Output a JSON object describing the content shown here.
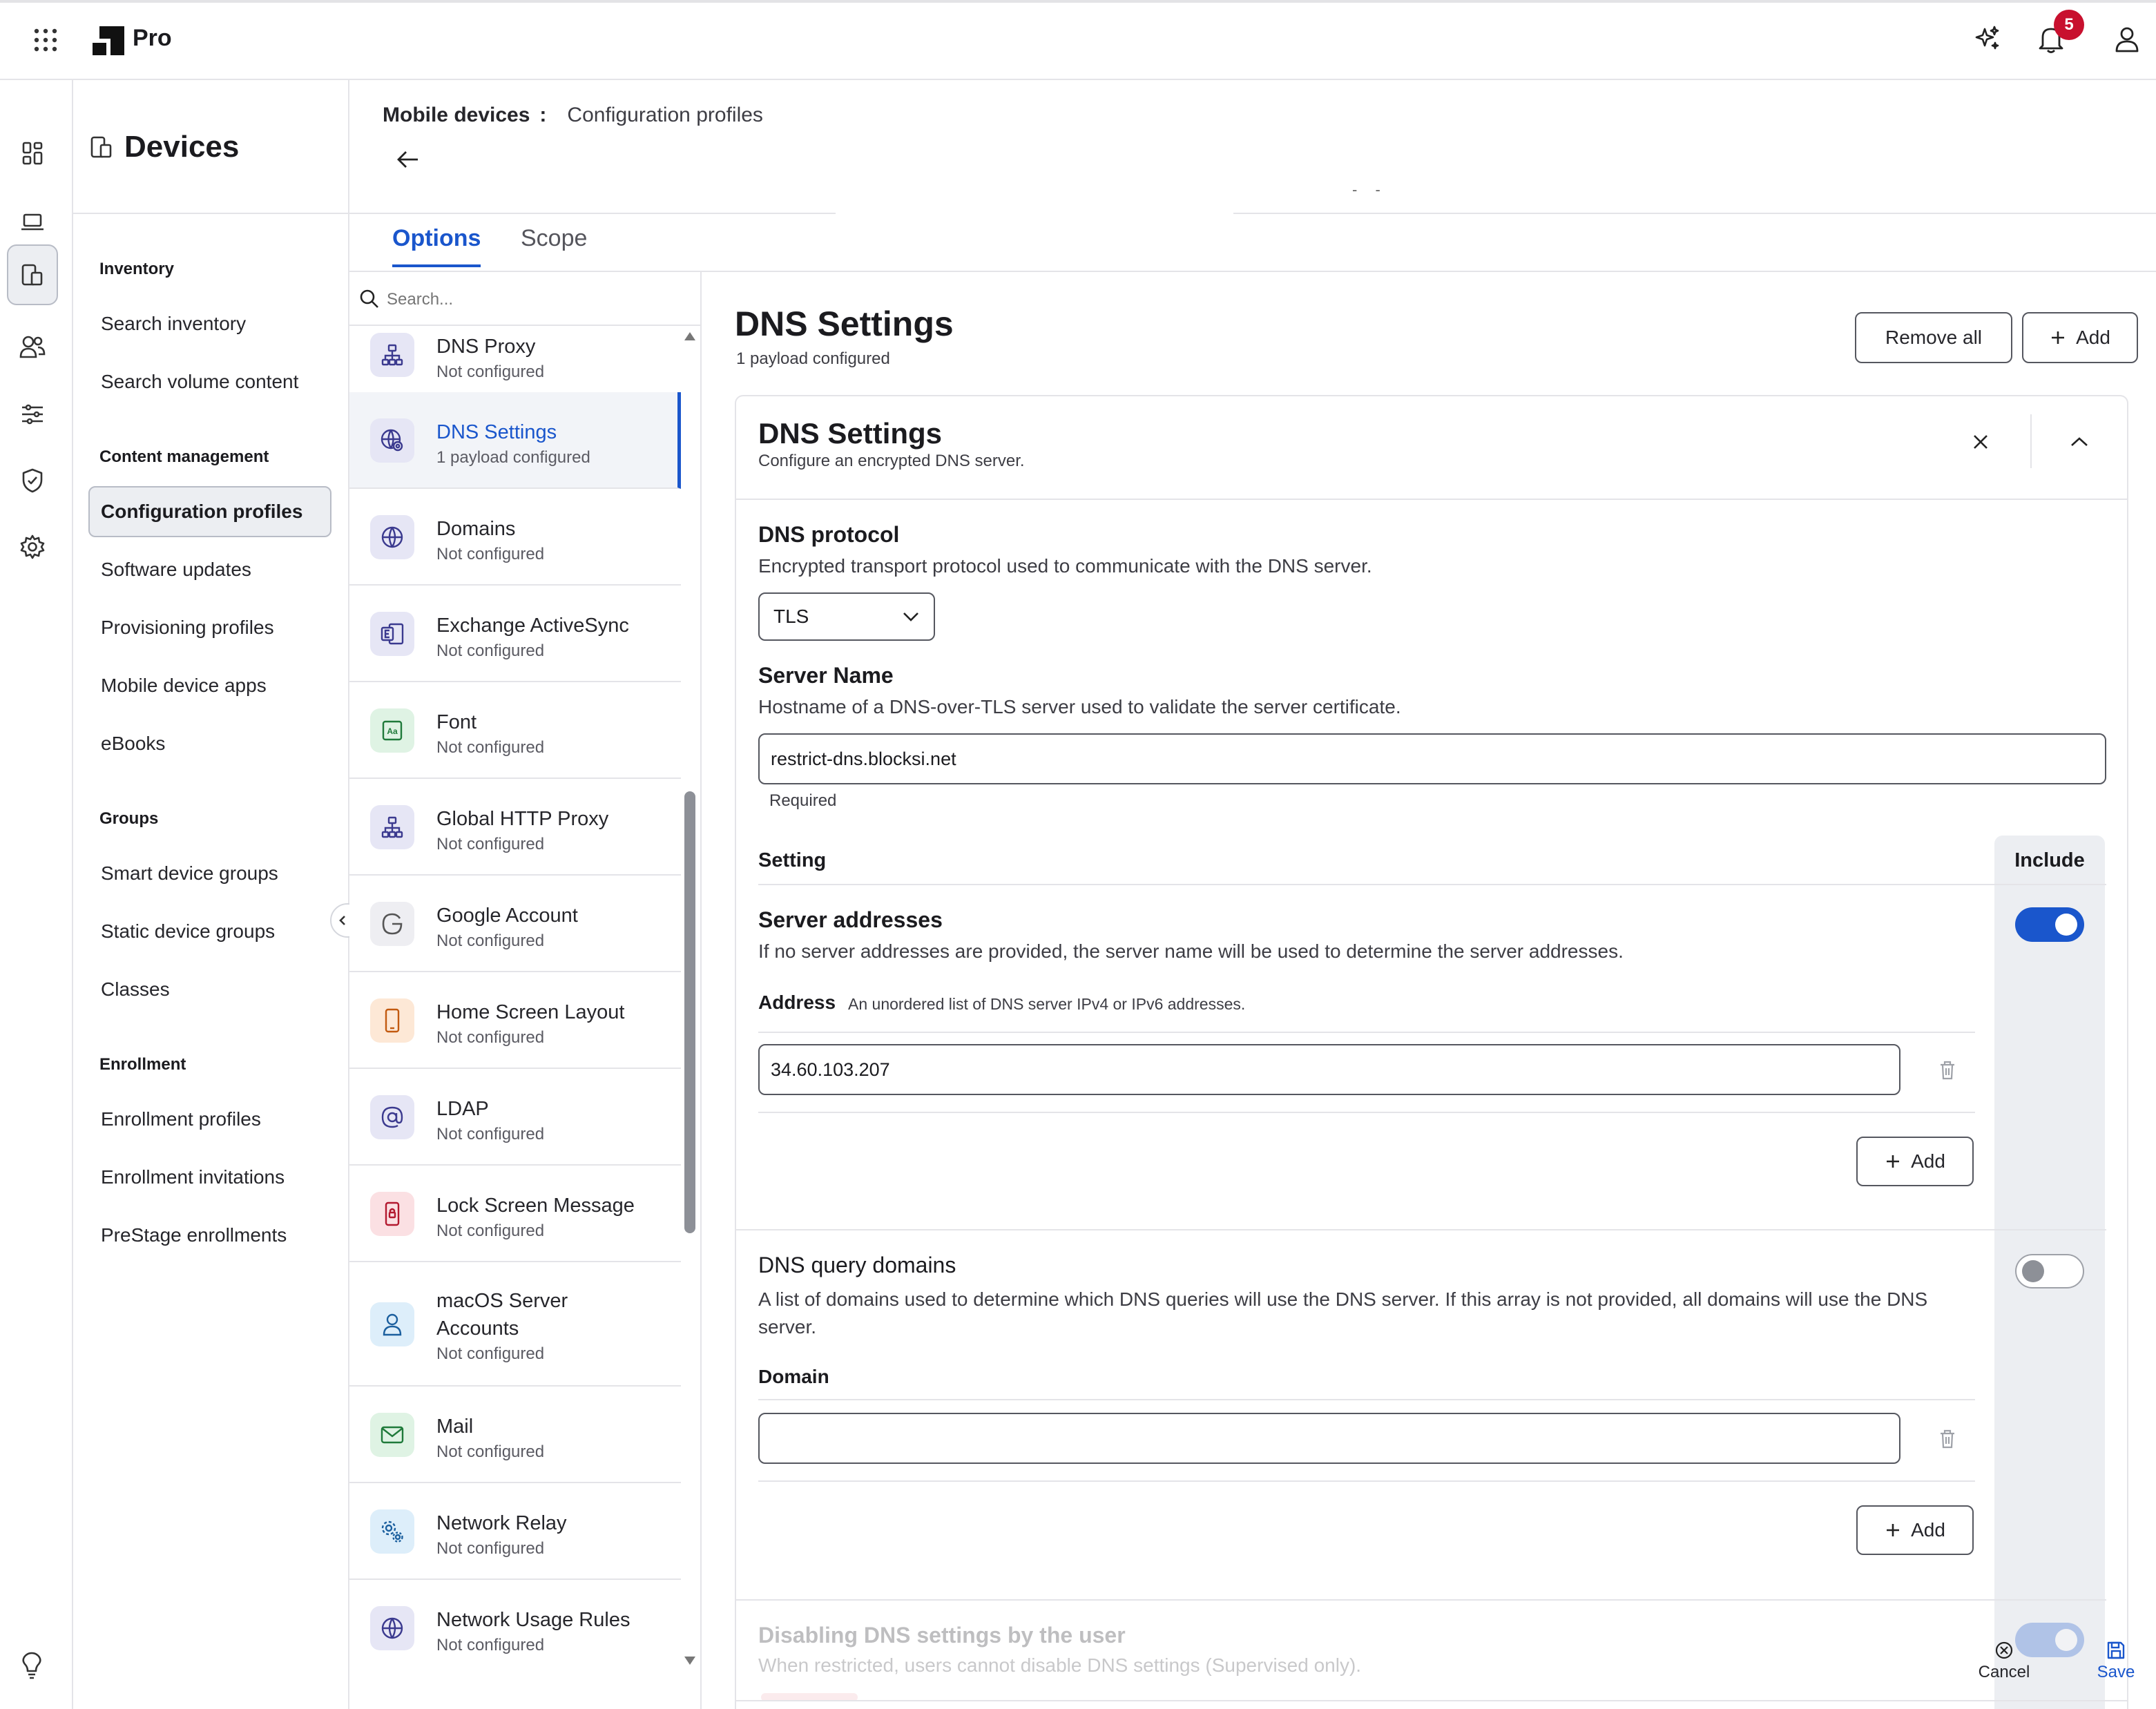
{
  "app": {
    "brand": "Pro",
    "notifications_count": "5"
  },
  "rail": {
    "icons": [
      "dashboard-icon",
      "computer-icon",
      "mobile-devices-icon",
      "users-icon",
      "settings-sliders-icon",
      "shield-icon",
      "gear-icon",
      "lightbulb-icon"
    ]
  },
  "leftnav": {
    "title": "Devices",
    "sections": [
      {
        "heading": "Inventory",
        "items": [
          "Search inventory",
          "Search volume content"
        ]
      },
      {
        "heading": "Content management",
        "items": [
          "Configuration profiles",
          "Software updates",
          "Provisioning profiles",
          "Mobile device apps",
          "eBooks"
        ]
      },
      {
        "heading": "Groups",
        "items": [
          "Smart device groups",
          "Static device groups",
          "Classes"
        ]
      },
      {
        "heading": "Enrollment",
        "items": [
          "Enrollment profiles",
          "Enrollment invitations",
          "PreStage enrollments"
        ]
      }
    ],
    "active_item": "Configuration profiles"
  },
  "header": {
    "breadcrumb_parent": "Mobile devices",
    "breadcrumb_sep": ":",
    "breadcrumb_current": "Configuration profiles",
    "dash_mark": "- -",
    "tabs": [
      {
        "label": "Options"
      },
      {
        "label": "Scope"
      }
    ]
  },
  "payload_list": {
    "search_placeholder": "Search...",
    "items": [
      {
        "name": "DNS Proxy",
        "status": "Not configured"
      },
      {
        "name": "DNS Settings",
        "status": "1 payload configured",
        "selected": true
      },
      {
        "name": "Domains",
        "status": "Not configured"
      },
      {
        "name": "Exchange ActiveSync",
        "status": "Not configured"
      },
      {
        "name": "Font",
        "status": "Not configured"
      },
      {
        "name": "Global HTTP Proxy",
        "status": "Not configured"
      },
      {
        "name": "Google Account",
        "status": "Not configured"
      },
      {
        "name": "Home Screen Layout",
        "status": "Not configured"
      },
      {
        "name": "LDAP",
        "status": "Not configured"
      },
      {
        "name": "Lock Screen Message",
        "status": "Not configured"
      },
      {
        "name": "macOS Server",
        "name2": "Accounts",
        "status": "Not configured"
      },
      {
        "name": "Mail",
        "status": "Not configured"
      },
      {
        "name": "Network Relay",
        "status": "Not configured"
      },
      {
        "name": "Network Usage Rules",
        "status": "Not configured"
      }
    ]
  },
  "content": {
    "title": "DNS Settings",
    "subtitle": "1 payload configured",
    "remove_all": "Remove all",
    "add": "Add",
    "card": {
      "title": "DNS Settings",
      "subtitle": "Configure an encrypted DNS server.",
      "dns_protocol_label": "DNS protocol",
      "dns_protocol_desc": "Encrypted transport protocol used to communicate with the DNS server.",
      "dns_protocol_value": "TLS",
      "server_name_label": "Server Name",
      "server_name_desc": "Hostname of a DNS-over-TLS server used to validate the server certificate.",
      "server_name_value": "restrict-dns.blocksi.net",
      "required_hint": "Required",
      "setting_header": "Setting",
      "include_header": "Include",
      "server_addresses_label": "Server addresses",
      "server_addresses_desc": "If no server addresses are provided, the server name will be used to determine the server addresses.",
      "server_addresses_included": true,
      "address_label": "Address",
      "address_desc": "An unordered list of DNS server IPv4 or IPv6 addresses.",
      "address_value": "34.60.103.207",
      "add_label": "Add",
      "dns_query_label": "DNS query domains",
      "dns_query_desc": "A list of domains used to determine which DNS queries will use the DNS server. If this array is not provided, all domains will use the DNS server.",
      "dns_query_included": false,
      "domain_label": "Domain",
      "domain_value": "",
      "disable_label": "Disabling DNS settings by the user",
      "disable_desc": "When restricted, users cannot disable DNS settings (Supervised only).",
      "disable_included": true
    },
    "actions": {
      "cancel": "Cancel",
      "save": "Save"
    }
  },
  "colors": {
    "accent": "#1a56cc",
    "badge": "#c8102e",
    "include_bg": "#eceef2"
  }
}
